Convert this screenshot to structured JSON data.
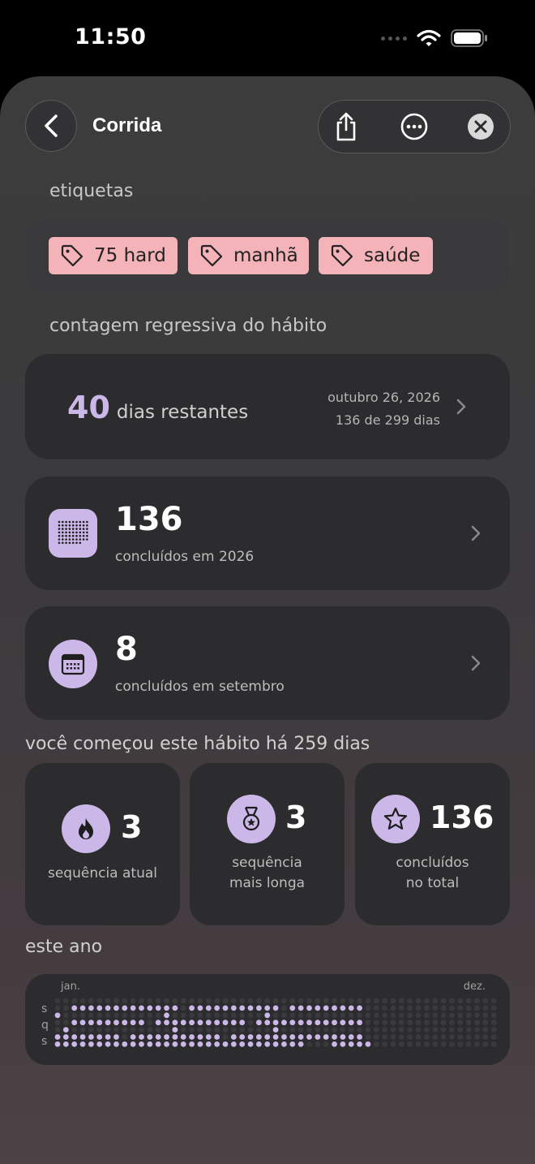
{
  "status": {
    "time": "11:50"
  },
  "header": {
    "title": "Corrida"
  },
  "tags": {
    "section_label": "etiquetas",
    "items": [
      "75 hard",
      "manhã",
      "saúde"
    ]
  },
  "countdown": {
    "section_label": "contagem regressiva do hábito",
    "days_number": "40",
    "days_text": "dias restantes",
    "date": "outubro 26, 2026",
    "progress_text": "136 de 299 dias"
  },
  "year_card": {
    "value": "136",
    "label": "concluídos em 2026"
  },
  "month_card": {
    "value": "8",
    "label": "concluídos em setembro"
  },
  "started": {
    "text": "você começou este hábito há 259 dias"
  },
  "stats": [
    {
      "icon": "flame-icon",
      "value": "3",
      "label_line1": "sequência atual",
      "label_line2": ""
    },
    {
      "icon": "medal-icon",
      "value": "3",
      "label_line1": "sequência",
      "label_line2": "mais longa"
    },
    {
      "icon": "star-icon",
      "value": "136",
      "label_line1": "concluídos",
      "label_line2": "no total"
    }
  ],
  "year_section": {
    "section_label": "este ano",
    "month_start": "jan.",
    "month_end": "dez.",
    "day_labels": [
      "s",
      "q",
      "s"
    ]
  },
  "colors": {
    "accent": "#cbb8e8",
    "tag": "#f4b3b8",
    "card": "#2c2c2e"
  }
}
